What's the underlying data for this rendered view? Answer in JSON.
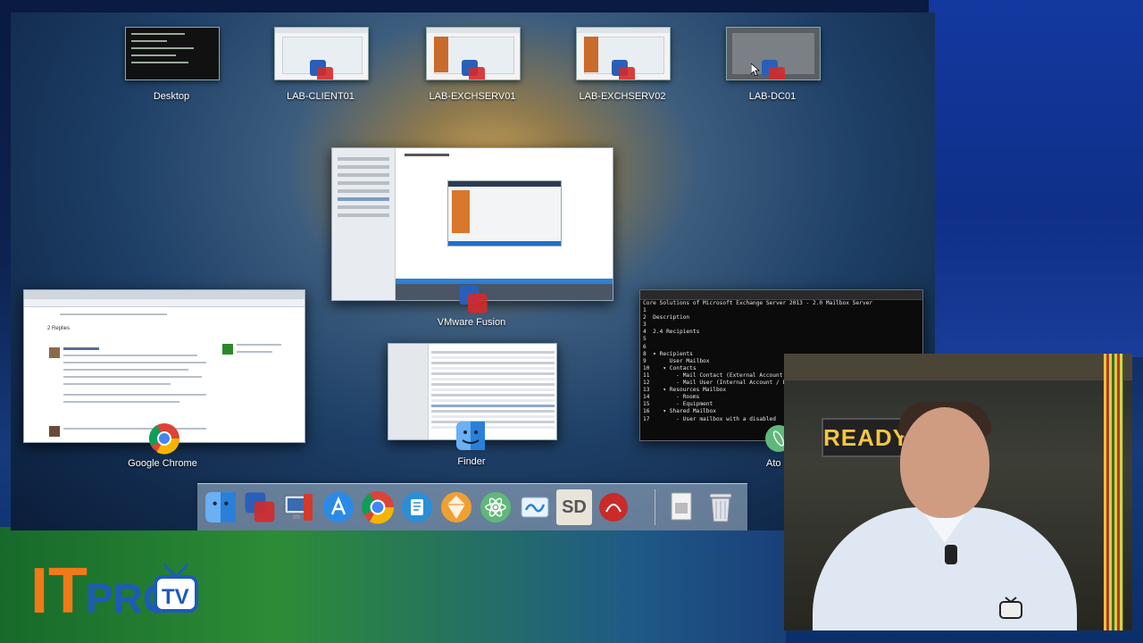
{
  "spaces": [
    {
      "label": "Desktop"
    },
    {
      "label": "LAB-CLIENT01"
    },
    {
      "label": "LAB-EXCHSERV01"
    },
    {
      "label": "LAB-EXCHSERV02"
    },
    {
      "label": "LAB-DC01"
    }
  ],
  "windows": {
    "vmware_fusion": {
      "label": "VMware Fusion"
    },
    "google_chrome": {
      "label": "Google Chrome",
      "replies_heading": "2 Replies"
    },
    "finder": {
      "label": "Finder"
    },
    "terminal": {
      "label": "Ato",
      "lines": [
        "Core Solutions of Microsoft Exchange Server 2013 - 2.0 Mailbox Server",
        "",
        "1",
        "2  Description",
        "3",
        "4  2.4 Recipients",
        "5",
        "6",
        "8  ▾ Recipients",
        "9       User Mailbox",
        "10    ▾ Contacts",
        "11        - Mail Contact (External Account / Ma",
        "12        - Mail User (Internal Account / Exter",
        "13    ▾ Resources Mailbox",
        "14        - Rooms",
        "15        - Equipment",
        "16    ▾ Shared Mailbox",
        "17        - User mailbox with a disabled"
      ]
    }
  },
  "dock": {
    "items": [
      {
        "name": "finder"
      },
      {
        "name": "vmware-fusion"
      },
      {
        "name": "remote-desktop"
      },
      {
        "name": "app-store"
      },
      {
        "name": "google-chrome"
      },
      {
        "name": "text-wrangler"
      },
      {
        "name": "sketch"
      },
      {
        "name": "atom"
      },
      {
        "name": "mindnode"
      },
      {
        "name": "sd"
      },
      {
        "name": "red-app"
      },
      {
        "name": "documents"
      },
      {
        "name": "trash"
      }
    ],
    "sd_label": "SD"
  },
  "presenter": {
    "sign_text": "READY"
  },
  "logo": {
    "it": "IT",
    "pro": "PRO",
    "tv": "TV"
  },
  "colors": {
    "vmware_red": "#d42a2a",
    "vmware_blue": "#2a5fb8",
    "logo_orange": "#f07a1a",
    "logo_blue": "#1e5ab8"
  }
}
